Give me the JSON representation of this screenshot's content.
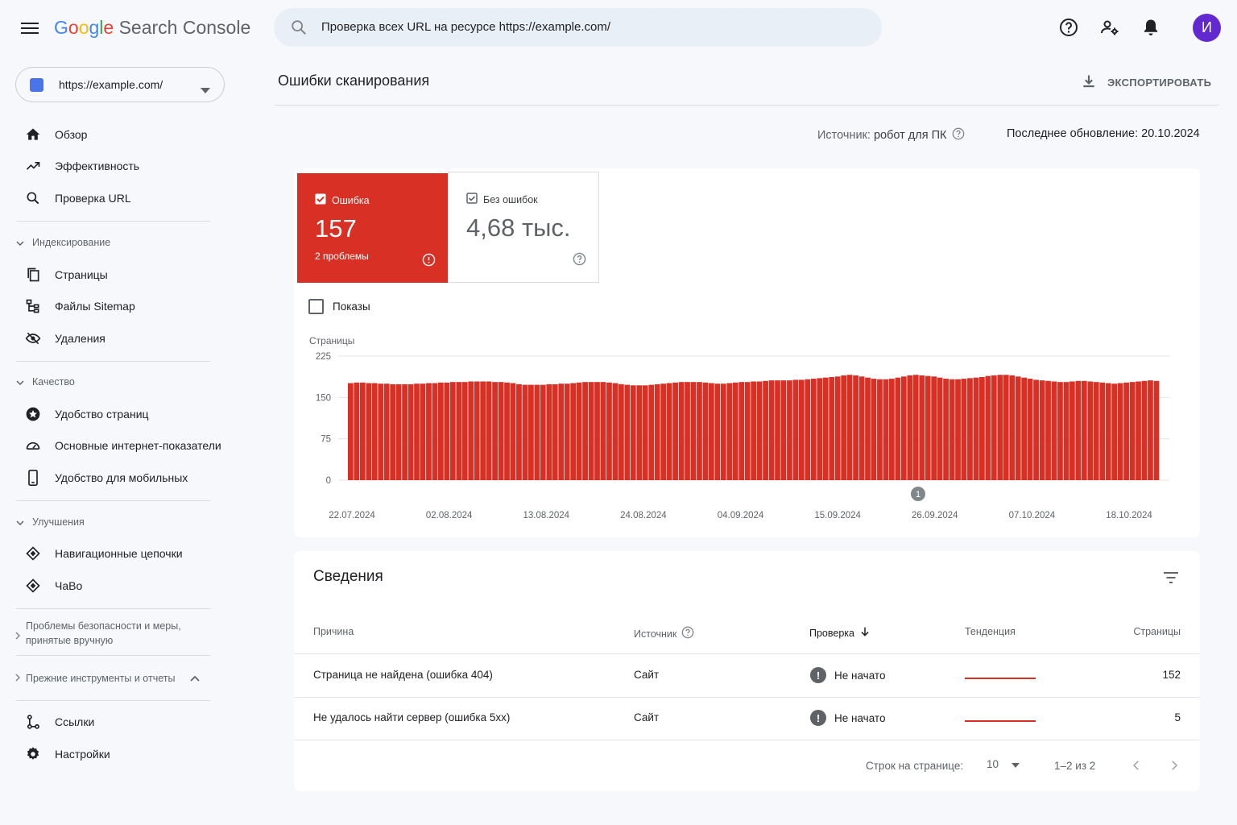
{
  "app": {
    "logo_google": [
      "G",
      "o",
      "o",
      "g",
      "l",
      "e"
    ],
    "logo_product": "Search Console"
  },
  "search": {
    "placeholder": "Проверка всех URL на ресурсе https://example.com/"
  },
  "user": {
    "avatar_letter": "И"
  },
  "property": {
    "url": "https://example.com/"
  },
  "sidebar": {
    "top": [
      {
        "label": "Обзор",
        "icon": "home-icon"
      },
      {
        "label": "Эффективность",
        "icon": "trending-up-icon"
      },
      {
        "label": "Проверка URL",
        "icon": "search-icon"
      }
    ],
    "sections": [
      {
        "header": "Индексирование",
        "items": [
          {
            "label": "Страницы",
            "icon": "pages-icon"
          },
          {
            "label": "Файлы Sitemap",
            "icon": "sitemap-icon"
          },
          {
            "label": "Удаления",
            "icon": "eye-off-icon"
          }
        ]
      },
      {
        "header": "Качество",
        "items": [
          {
            "label": "Удобство страниц",
            "icon": "star-badge-icon"
          },
          {
            "label": "Основные интернет-показатели",
            "icon": "speedometer-icon"
          },
          {
            "label": "Удобство для мобильных",
            "icon": "phone-icon"
          }
        ]
      },
      {
        "header": "Улучшения",
        "items": [
          {
            "label": "Навигационные цепочки",
            "icon": "diamond-layers-icon"
          },
          {
            "label": "ЧаВо",
            "icon": "diamond-layers-icon"
          }
        ]
      }
    ],
    "security": "Проблемы безопасности и меры, принятые вручную",
    "legacy": "Прежние инструменты и отчеты",
    "bottom": [
      {
        "label": "Ссылки",
        "icon": "links-icon"
      },
      {
        "label": "Настройки",
        "icon": "settings-icon"
      }
    ]
  },
  "main": {
    "title": "Ошибки сканирования",
    "export_label": "ЭКСПОРТИРОВАТЬ",
    "source_label": "Источник:",
    "source_value": "робот для ПК",
    "last_update": "Последнее обновление: 20.10.2024"
  },
  "metrics": {
    "error": {
      "label": "Ошибка",
      "value": "157",
      "sub": "2 проблемы",
      "checked": true
    },
    "ok": {
      "label": "Без ошибок",
      "value": "4,68 тыс.",
      "checked": true
    },
    "impressions": {
      "label": "Показы",
      "checked": false
    }
  },
  "chart_data": {
    "type": "bar",
    "ylabel": "Страницы",
    "ylim": [
      0,
      225
    ],
    "yticks": [
      0,
      75,
      150,
      225
    ],
    "xtick_labels": [
      "22.07.2024",
      "02.08.2024",
      "13.08.2024",
      "24.08.2024",
      "04.09.2024",
      "15.09.2024",
      "26.09.2024",
      "07.10.2024",
      "18.10.2024"
    ],
    "annotation": {
      "label": "1",
      "near": "24.09.2024"
    },
    "bar_color": "#d93025",
    "values": [
      176,
      177,
      177,
      176,
      176,
      175,
      175,
      174,
      174,
      174,
      174,
      175,
      175,
      176,
      176,
      177,
      177,
      178,
      178,
      178,
      179,
      179,
      179,
      179,
      178,
      178,
      177,
      176,
      174,
      173,
      173,
      173,
      173,
      174,
      174,
      175,
      175,
      176,
      177,
      178,
      178,
      178,
      178,
      177,
      176,
      174,
      173,
      172,
      172,
      172,
      173,
      174,
      175,
      176,
      177,
      178,
      178,
      178,
      178,
      177,
      176,
      175,
      175,
      176,
      177,
      178,
      178,
      179,
      179,
      180,
      181,
      181,
      181,
      181,
      182,
      182,
      183,
      184,
      185,
      186,
      187,
      188,
      190,
      191,
      190,
      188,
      186,
      184,
      183,
      183,
      184,
      186,
      188,
      190,
      191,
      190,
      189,
      188,
      186,
      184,
      183,
      183,
      184,
      185,
      186,
      187,
      189,
      190,
      191,
      191,
      190,
      188,
      186,
      184,
      182,
      181,
      180,
      179,
      178,
      178,
      179,
      180,
      180,
      179,
      178,
      177,
      176,
      175,
      176,
      177,
      178,
      179,
      180,
      181,
      180
    ]
  },
  "details": {
    "title": "Сведения",
    "columns": {
      "reason": "Причина",
      "source": "Источник",
      "check": "Проверка",
      "trend": "Тенденция",
      "pages": "Страницы"
    },
    "rows": [
      {
        "reason": "Страница не найдена (ошибка 404)",
        "source": "Сайт",
        "status": "Не начато",
        "pages": "152"
      },
      {
        "reason": "Не удалось найти сервер (ошибка 5xx)",
        "source": "Сайт",
        "status": "Не начато",
        "pages": "5"
      }
    ],
    "rows_per_page_label": "Строк на странице:",
    "rows_per_page": "10",
    "range": "1–2 из 2"
  }
}
